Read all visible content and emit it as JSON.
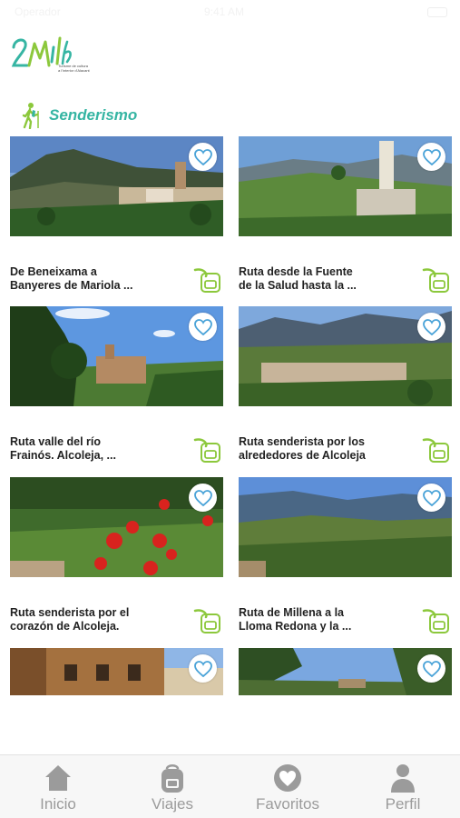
{
  "status_bar": {
    "carrier": "Operador",
    "time": "9:41 AM"
  },
  "logo": {
    "mark": "2M",
    "tagline_line1": "Turisme de cultura",
    "tagline_line2": "a l'interior d'Alacant"
  },
  "section": {
    "title": "Senderismo",
    "accent_color": "#36b5a3"
  },
  "routes": [
    {
      "line1": "De Beneixama a",
      "line2": "Banyeres de Mariola ..."
    },
    {
      "line1": "Ruta desde la Fuente",
      "line2": "de la Salud hasta la ..."
    },
    {
      "line1": "Ruta valle del río",
      "line2": "Frainós. Alcoleja, ..."
    },
    {
      "line1": "Ruta senderista por los",
      "line2": "alrededores de Alcoleja"
    },
    {
      "line1": "Ruta senderista por el",
      "line2": "corazón de Alcoleja."
    },
    {
      "line1": "Ruta de Millena a la",
      "line2": "Lloma Redona y la ..."
    },
    {
      "line1": "",
      "line2": ""
    },
    {
      "line1": "",
      "line2": ""
    }
  ],
  "tab_bar": {
    "home": "Inicio",
    "trips": "Viajes",
    "favorites": "Favoritos",
    "profile": "Perfil"
  },
  "icons": {
    "favorite": "heart-outline-icon",
    "route_type": "backpack-icon",
    "section": "hiker-icon"
  },
  "colors": {
    "heart_blue": "#4aa3d8",
    "backpack_green": "#8cc83c",
    "tab_grey": "#9b9b9b"
  }
}
